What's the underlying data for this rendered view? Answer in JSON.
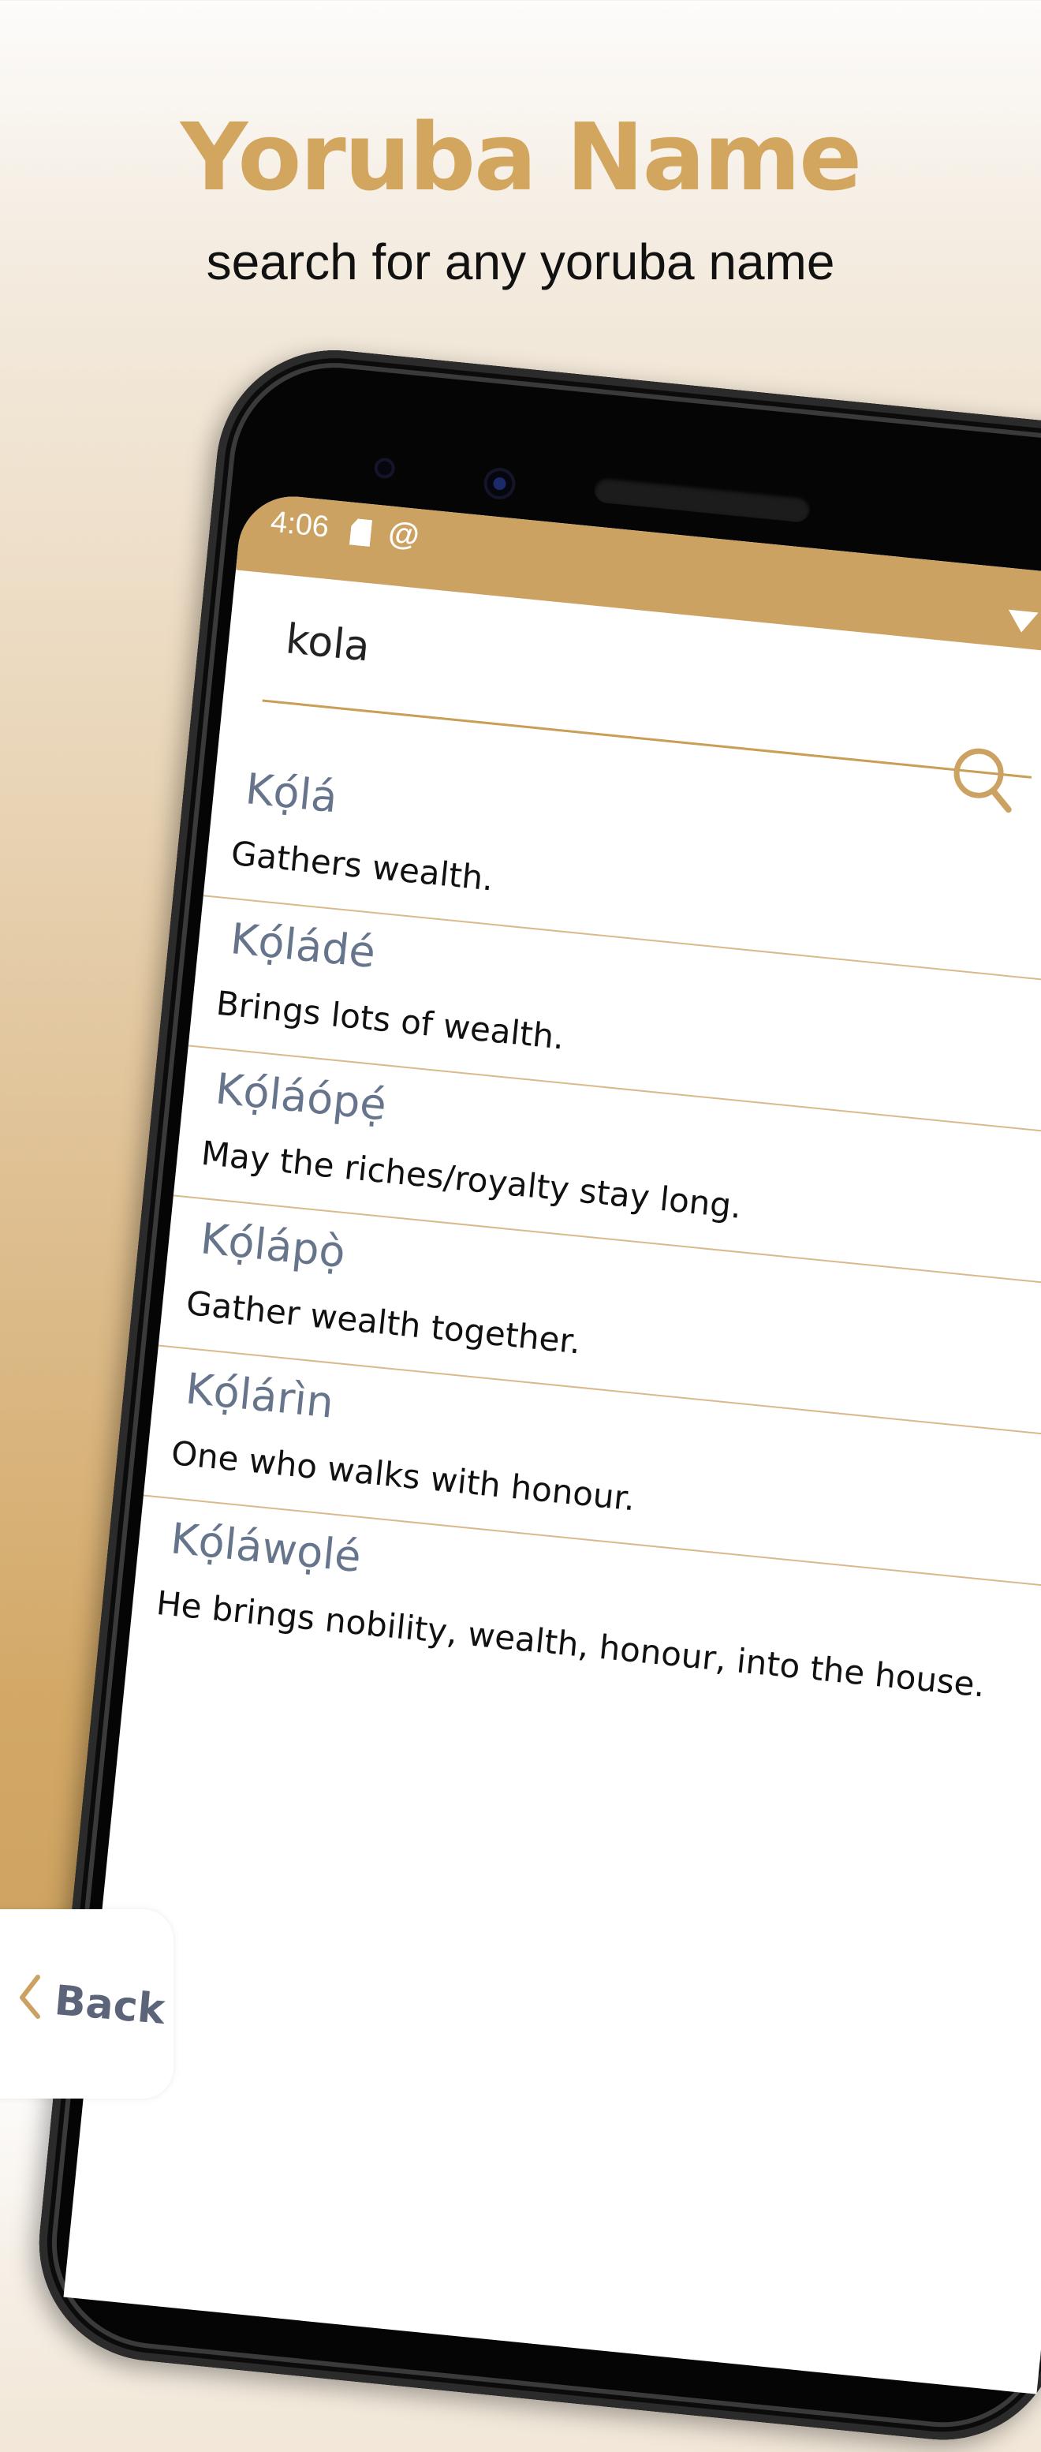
{
  "header": {
    "title": "Yoruba Name",
    "subtitle": "search for any yoruba name"
  },
  "status_bar": {
    "time": "4:06",
    "icons": [
      "sd-card-icon",
      "at-icon",
      "wifi-icon",
      "signal-icon"
    ]
  },
  "search": {
    "value": "kola",
    "icon": "search-icon"
  },
  "results": [
    {
      "name": "Kọ́lá",
      "meaning": "Gathers wealth."
    },
    {
      "name": "Kọ́ládé",
      "meaning": "Brings lots of wealth."
    },
    {
      "name": "Kọ́láópẹ́",
      "meaning": "May the riches/royalty stay long."
    },
    {
      "name": "Kọ́lápọ̀",
      "meaning": "Gather wealth together."
    },
    {
      "name": "Kọ́lárìn",
      "meaning": "One who walks with honour."
    },
    {
      "name": "Kọ́láwọlé",
      "meaning": "He brings nobility, wealth, honour, into the house."
    }
  ],
  "back": {
    "label": "Back",
    "icon": "chevron-left-icon"
  },
  "colors": {
    "accent": "#cba262",
    "title": "#d3a65f",
    "name_text": "#66758c"
  }
}
